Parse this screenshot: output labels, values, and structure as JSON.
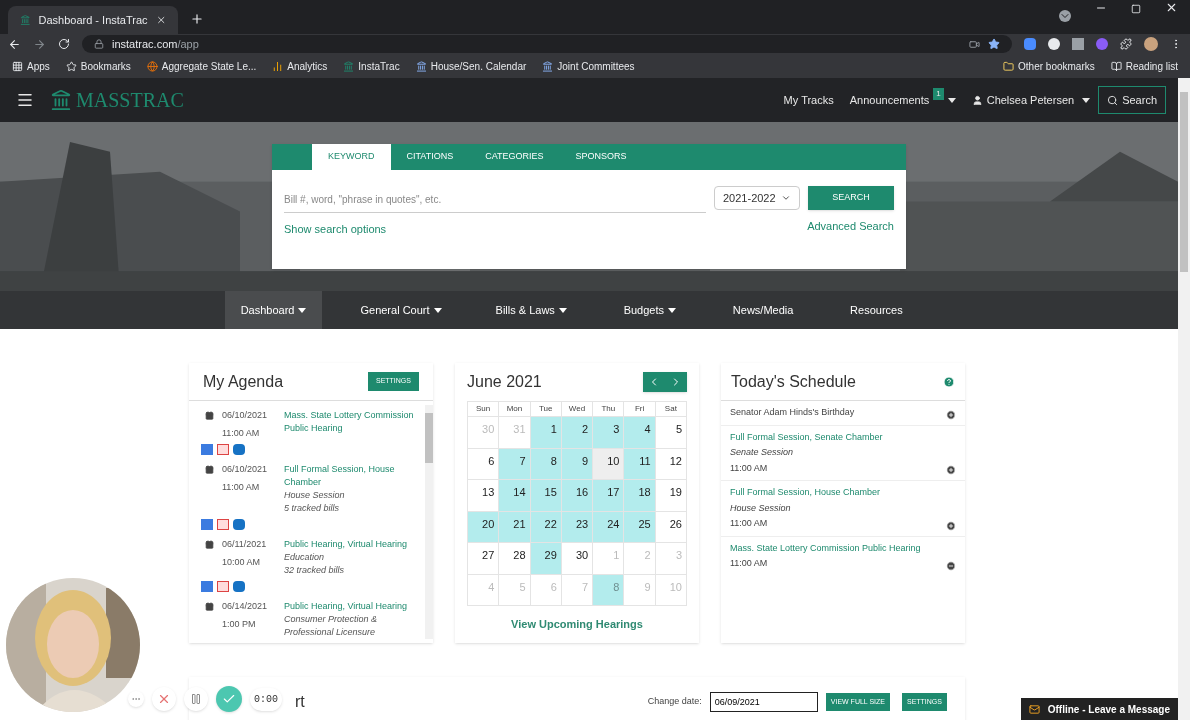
{
  "browser": {
    "tab_title": "Dashboard - InstaTrac",
    "url_host": "instatrac.com",
    "url_path": "/app",
    "bookmarks": [
      "Apps",
      "Bookmarks",
      "Aggregate State Le...",
      "Analytics",
      "InstaTrac",
      "House/Sen. Calendar",
      "Joint Committees"
    ],
    "other_bookmarks": "Other bookmarks",
    "reading_list": "Reading list"
  },
  "header": {
    "logo": "MASSTRAC",
    "my_tracks": "My Tracks",
    "announcements": "Announcements",
    "announcement_count": "1",
    "user": "Chelsea Petersen",
    "search": "Search"
  },
  "search_panel": {
    "tabs": [
      {
        "label": "KEYWORD",
        "selected": true
      },
      {
        "label": "CITATIONS",
        "selected": false
      },
      {
        "label": "CATEGORIES",
        "selected": false
      },
      {
        "label": "SPONSORS",
        "selected": false
      }
    ],
    "placeholder": "Bill #, word, \"phrase in quotes\", etc.",
    "session": "2021-2022",
    "search_button": "SEARCH",
    "show_options": "Show search options",
    "advanced": "Advanced Search"
  },
  "main_nav": [
    {
      "label": "Dashboard",
      "dropdown": true,
      "selected": true
    },
    {
      "label": "General Court",
      "dropdown": true,
      "selected": false
    },
    {
      "label": "Bills & Laws",
      "dropdown": true,
      "selected": false
    },
    {
      "label": "Budgets",
      "dropdown": true,
      "selected": false
    },
    {
      "label": "News/Media",
      "dropdown": false,
      "selected": false
    },
    {
      "label": "Resources",
      "dropdown": false,
      "selected": false
    }
  ],
  "agenda": {
    "title": "My Agenda",
    "settings": "SETTINGS",
    "items": [
      {
        "date": "06/10/2021",
        "time": "11:00 AM",
        "title": "Mass. State Lottery Commission Public Hearing",
        "calendar_links": true
      },
      {
        "date": "06/10/2021",
        "time": "11:00 AM",
        "title": "Full Formal Session, House Chamber",
        "notes": [
          "House Session",
          "5 tracked bills"
        ],
        "calendar_links": true
      },
      {
        "date": "06/11/2021",
        "time": "10:00 AM",
        "title": "Public Hearing, Virtual Hearing",
        "notes": [
          "Education",
          "32 tracked bills"
        ],
        "calendar_links": true
      },
      {
        "date": "06/14/2021",
        "time": "1:00 PM",
        "title": "Public Hearing, Virtual Hearing",
        "notes": [
          "Consumer Protection & Professional Licensure"
        ],
        "calendar_links": false
      }
    ]
  },
  "calendar": {
    "title": "June 2021",
    "weekdays": [
      "Sun",
      "Mon",
      "Tue",
      "Wed",
      "Thu",
      "Fri",
      "Sat"
    ],
    "days": [
      {
        "day": "30",
        "muted": true,
        "highlighted": false,
        "selected": false
      },
      {
        "day": "31",
        "muted": true,
        "highlighted": false,
        "selected": false
      },
      {
        "day": "1",
        "muted": false,
        "highlighted": true,
        "selected": false
      },
      {
        "day": "2",
        "muted": false,
        "highlighted": true,
        "selected": false
      },
      {
        "day": "3",
        "muted": false,
        "highlighted": true,
        "selected": false
      },
      {
        "day": "4",
        "muted": false,
        "highlighted": true,
        "selected": false
      },
      {
        "day": "5",
        "muted": false,
        "highlighted": false,
        "selected": false
      },
      {
        "day": "6",
        "muted": false,
        "highlighted": false,
        "selected": false
      },
      {
        "day": "7",
        "muted": false,
        "highlighted": true,
        "selected": false
      },
      {
        "day": "8",
        "muted": false,
        "highlighted": true,
        "selected": false
      },
      {
        "day": "9",
        "muted": false,
        "highlighted": true,
        "selected": false
      },
      {
        "day": "10",
        "muted": false,
        "highlighted": false,
        "selected": true
      },
      {
        "day": "11",
        "muted": false,
        "highlighted": true,
        "selected": false
      },
      {
        "day": "12",
        "muted": false,
        "highlighted": false,
        "selected": false
      },
      {
        "day": "13",
        "muted": false,
        "highlighted": false,
        "selected": false
      },
      {
        "day": "14",
        "muted": false,
        "highlighted": true,
        "selected": false
      },
      {
        "day": "15",
        "muted": false,
        "highlighted": true,
        "selected": false
      },
      {
        "day": "16",
        "muted": false,
        "highlighted": true,
        "selected": false
      },
      {
        "day": "17",
        "muted": false,
        "highlighted": true,
        "selected": false
      },
      {
        "day": "18",
        "muted": false,
        "highlighted": true,
        "selected": false
      },
      {
        "day": "19",
        "muted": false,
        "highlighted": false,
        "selected": false
      },
      {
        "day": "20",
        "muted": false,
        "highlighted": true,
        "selected": false
      },
      {
        "day": "21",
        "muted": false,
        "highlighted": true,
        "selected": false
      },
      {
        "day": "22",
        "muted": false,
        "highlighted": true,
        "selected": false
      },
      {
        "day": "23",
        "muted": false,
        "highlighted": true,
        "selected": false
      },
      {
        "day": "24",
        "muted": false,
        "highlighted": true,
        "selected": false
      },
      {
        "day": "25",
        "muted": false,
        "highlighted": true,
        "selected": false
      },
      {
        "day": "26",
        "muted": false,
        "highlighted": false,
        "selected": false
      },
      {
        "day": "27",
        "muted": false,
        "highlighted": false,
        "selected": false
      },
      {
        "day": "28",
        "muted": false,
        "highlighted": false,
        "selected": false
      },
      {
        "day": "29",
        "muted": false,
        "highlighted": true,
        "selected": false
      },
      {
        "day": "30",
        "muted": false,
        "highlighted": false,
        "selected": false
      },
      {
        "day": "1",
        "muted": true,
        "highlighted": false,
        "selected": false
      },
      {
        "day": "2",
        "muted": true,
        "highlighted": false,
        "selected": false
      },
      {
        "day": "3",
        "muted": true,
        "highlighted": false,
        "selected": false
      },
      {
        "day": "4",
        "muted": true,
        "highlighted": false,
        "selected": false
      },
      {
        "day": "5",
        "muted": true,
        "highlighted": false,
        "selected": false
      },
      {
        "day": "6",
        "muted": true,
        "highlighted": false,
        "selected": false
      },
      {
        "day": "7",
        "muted": true,
        "highlighted": false,
        "selected": false
      },
      {
        "day": "8",
        "muted": true,
        "highlighted": true,
        "selected": false
      },
      {
        "day": "9",
        "muted": true,
        "highlighted": false,
        "selected": false
      },
      {
        "day": "10",
        "muted": true,
        "highlighted": false,
        "selected": false
      }
    ],
    "footer_link": "View Upcoming Hearings"
  },
  "schedule": {
    "title": "Today's Schedule",
    "items": [
      {
        "title": "Senator Adam Hinds's Birthday",
        "linked": false,
        "expanded": false
      },
      {
        "title": "Full Formal Session, Senate Chamber",
        "subtitle": "Senate Session",
        "time": "11:00 AM",
        "linked": true,
        "expanded": false
      },
      {
        "title": "Full Formal Session, House Chamber",
        "subtitle": "House Session",
        "time": "11:00 AM",
        "linked": true,
        "expanded": false
      },
      {
        "title": "Mass. State Lottery Commission Public Hearing",
        "time": "11:00 AM",
        "linked": true,
        "expanded": true
      }
    ]
  },
  "report": {
    "title": "rt",
    "change_date_label": "Change date:",
    "date": "06/09/2021",
    "view_full_size": "VIEW FULL SIZE",
    "settings": "SETTINGS"
  },
  "recorder": {
    "time": "0:00"
  },
  "chat": {
    "label": "Offline - Leave a Message"
  }
}
